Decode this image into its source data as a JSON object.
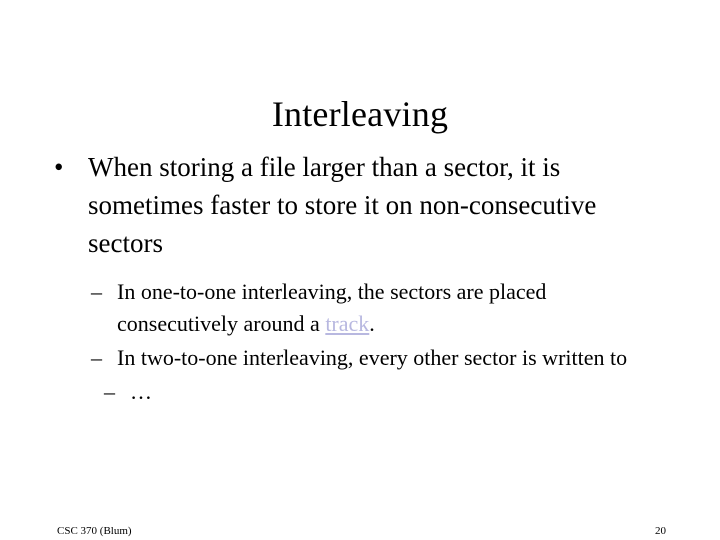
{
  "slide": {
    "title": "Interleaving",
    "background_color": "#ffffff",
    "text_color": "#000000",
    "link_color": "#b8b8e0"
  },
  "body": {
    "level1": {
      "marker": "•",
      "text": "When storing a file larger than a sector, it is sometimes faster to store it on non-consecutive sectors"
    },
    "level2": [
      {
        "marker": "–",
        "text_before_link": "In one-to-one interleaving, the sectors are placed consecutively around a ",
        "link_text": "track",
        "text_after_link": "."
      },
      {
        "marker": "–",
        "text": "In two-to-one interleaving, every other sector is written to"
      },
      {
        "marker": "–",
        "text": "…"
      }
    ]
  },
  "footer": {
    "course": "CSC 370 (Blum)",
    "page_number": "20"
  }
}
